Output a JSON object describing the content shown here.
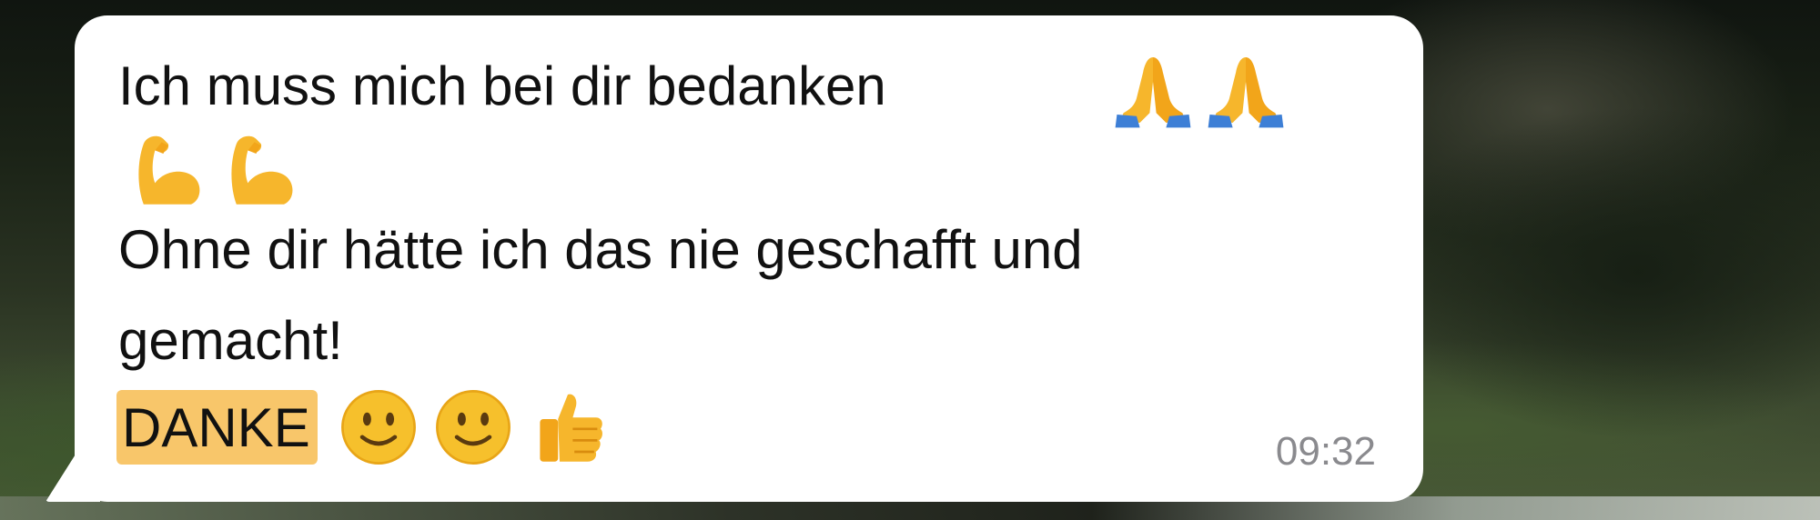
{
  "message": {
    "line1": "Ich muss mich bei dir bedanken",
    "line1_emojis": [
      "folded-hands-icon",
      "folded-hands-icon"
    ],
    "line2_emojis": [
      "flexed-biceps-icon",
      "flexed-biceps-icon"
    ],
    "line2": "Ohne dir hätte ich das nie geschafft und",
    "line3": "gemacht!",
    "highlight": "DANKE",
    "line4_emojis": [
      "slightly-smiling-face-icon",
      "slightly-smiling-face-icon",
      "thumbs-up-icon"
    ],
    "time": "09:32"
  },
  "colors": {
    "bubble": "#ffffff",
    "text": "#111111",
    "highlight": "#f8c66a",
    "timestamp": "#8a8a8e",
    "emoji_skin": "#f6b62c"
  }
}
